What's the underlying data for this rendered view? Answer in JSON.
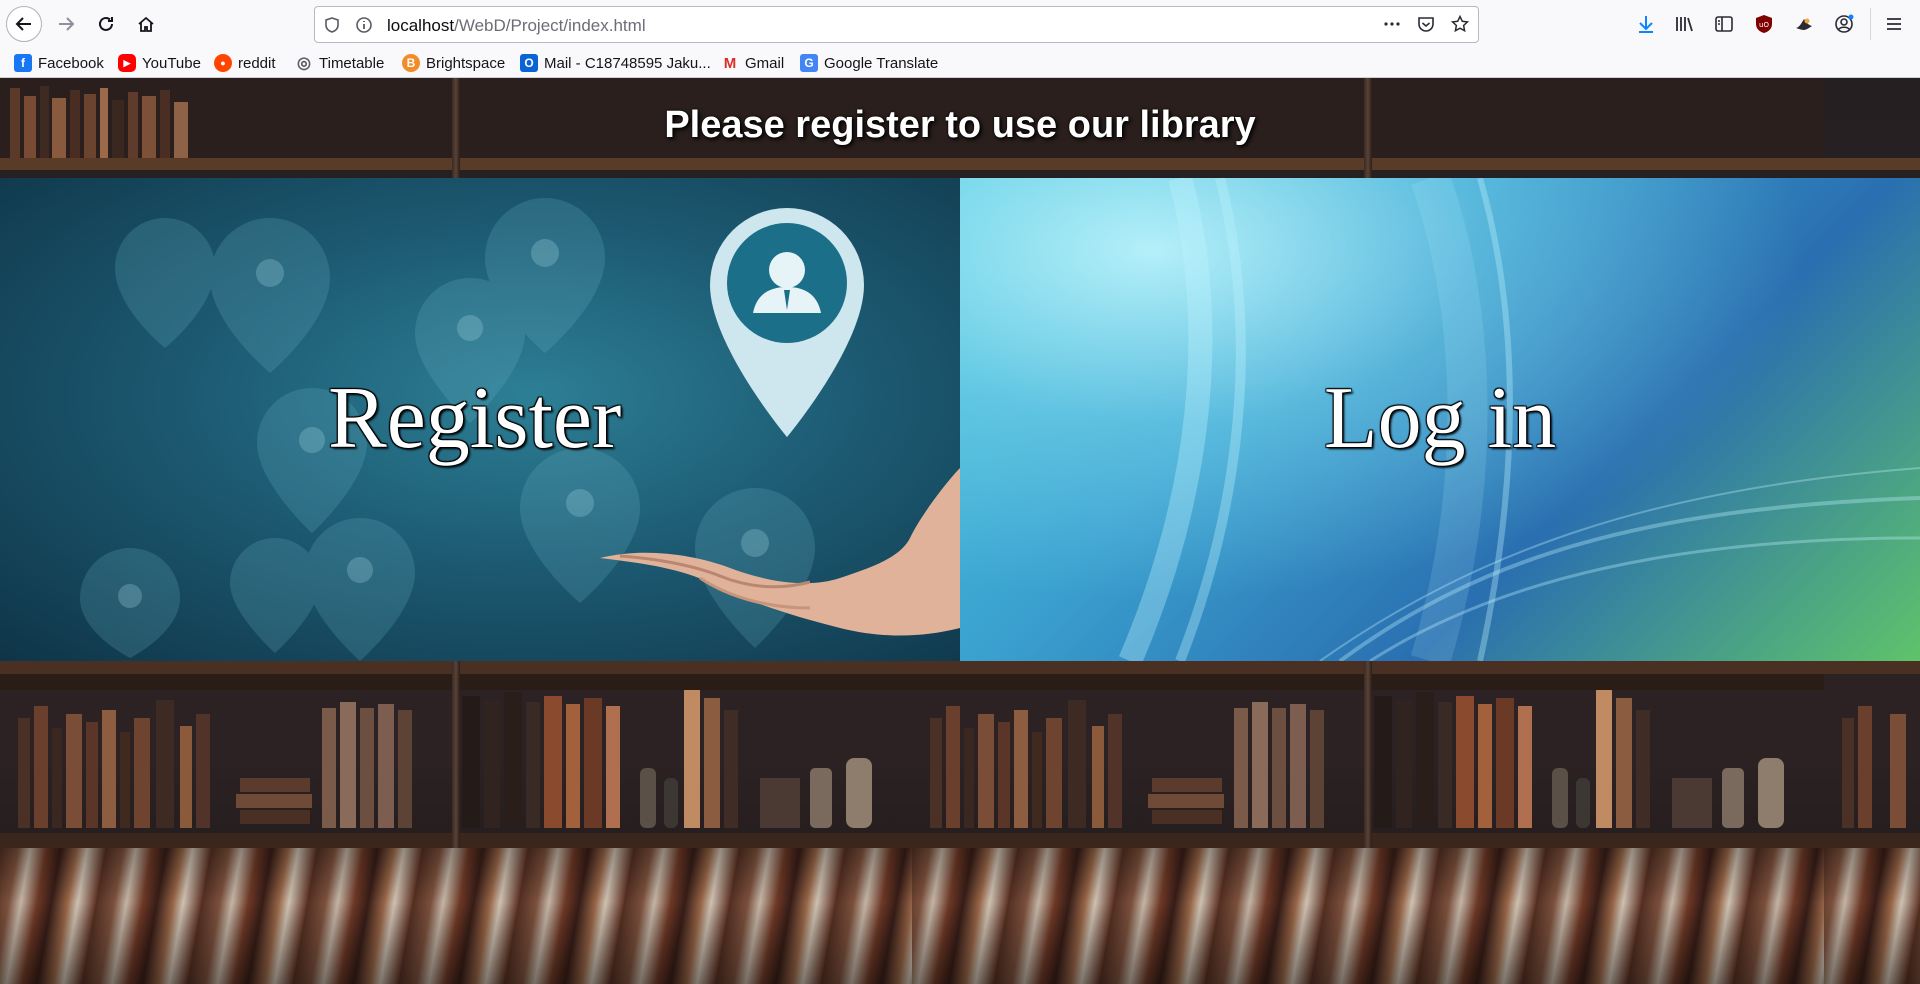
{
  "browser": {
    "url_host": "localhost",
    "url_path": "/WebD/Project/index.html",
    "icons": {
      "back": "arrow-left-icon",
      "forward": "arrow-right-icon",
      "reload": "reload-icon",
      "home": "home-icon",
      "shield": "tracking-shield-icon",
      "info": "site-info-icon",
      "more": "more-actions-icon",
      "pocket": "pocket-icon",
      "bookmark": "star-icon",
      "downloads": "download-icon",
      "library": "library-icon",
      "sidebar": "sidebar-icon",
      "ublock": "ublock-icon",
      "extension": "extension-icon",
      "account": "account-icon",
      "menu": "hamburger-menu-icon"
    }
  },
  "bookmarks": [
    {
      "label": "Facebook",
      "color": "#1877f2",
      "glyph": "f"
    },
    {
      "label": "YouTube",
      "color": "#ff0000",
      "glyph": "▶"
    },
    {
      "label": "reddit",
      "color": "#ff4500",
      "glyph": "●"
    },
    {
      "label": "Timetable",
      "color": "#5b5b66",
      "glyph": "◎"
    },
    {
      "label": "Brightspace",
      "color": "#f28c28",
      "glyph": "B"
    },
    {
      "label": "Mail - C18748595 Jaku...",
      "color": "#0a64d6",
      "glyph": "O"
    },
    {
      "label": "Gmail",
      "color": "#d93025",
      "glyph": "M"
    },
    {
      "label": "Google Translate",
      "color": "#4285f4",
      "glyph": "G"
    }
  ],
  "page": {
    "title": "Please register to use our library",
    "register_label": "Register",
    "login_label": "Log in"
  },
  "colors": {
    "register_panel": "#1c5a72",
    "login_panel": "#3aa0cf",
    "title_text": "#ffffff"
  }
}
